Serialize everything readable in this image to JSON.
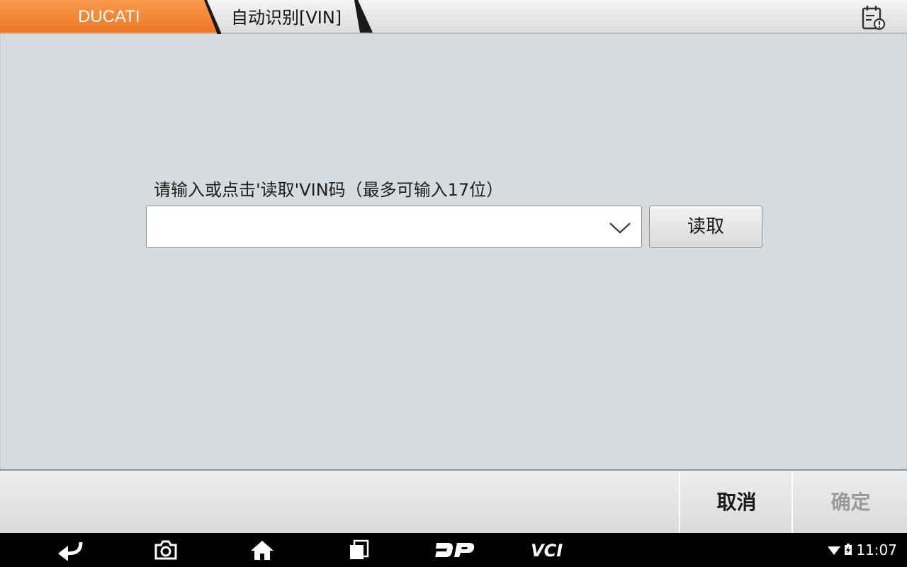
{
  "breadcrumb": {
    "brand": "DUCATI",
    "current": "自动识别[VIN]"
  },
  "form": {
    "prompt": "请输入或点击'读取'VIN码（最多可输入17位）",
    "vin_value": "",
    "read_label": "读取"
  },
  "actions": {
    "cancel_label": "取消",
    "ok_label": "确定"
  },
  "navbar": {
    "icons": [
      "back-icon",
      "camera-icon",
      "home-icon",
      "recent-apps-icon",
      "dp-icon",
      "vci-icon"
    ],
    "dp_label": "DP",
    "vci_label": "VCI"
  },
  "status": {
    "time": "11:07"
  },
  "colors": {
    "brand_orange": "#ef7624",
    "panel_bg": "#d7dbde",
    "disabled_text": "#9a9a9a"
  }
}
